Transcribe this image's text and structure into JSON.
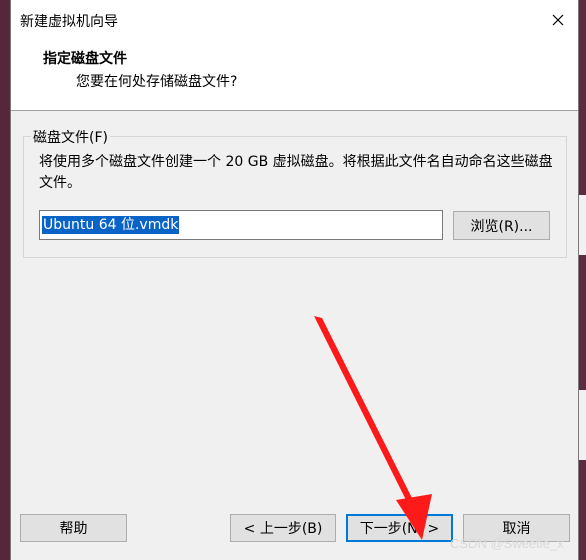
{
  "window": {
    "title": "新建虚拟机向导"
  },
  "header": {
    "title": "指定磁盘文件",
    "subtitle": "您要在何处存储磁盘文件?"
  },
  "disk_file_group": {
    "label": "磁盘文件(F)",
    "description": "将使用多个磁盘文件创建一个 20 GB 虚拟磁盘。将根据此文件名自动命名这些磁盘文件。",
    "file_name_value": "Ubuntu 64 位.vmdk",
    "browse_label": "浏览(R)..."
  },
  "footer": {
    "help_label": "帮助",
    "back_label": "< 上一步(B)",
    "next_label": "下一步(N) >",
    "cancel_label": "取消"
  },
  "watermark": "CSDN @Sweetie_x",
  "icons": {
    "close": "close-icon",
    "annotation": "red-arrow-annotation"
  },
  "colors": {
    "selection": "#0a64c8",
    "focus_border": "#0078d7",
    "annotation_arrow": "#ff1a1a"
  }
}
